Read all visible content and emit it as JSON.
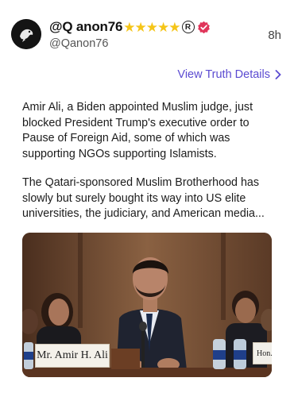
{
  "post": {
    "display_name": "@Q anon76",
    "handle": "@Qanon76",
    "time": "8h",
    "badges": {
      "stars": [
        "★",
        "★",
        "★",
        "★",
        "★"
      ],
      "registered": "R",
      "verified_color": "#e0355a"
    },
    "details_link": "View Truth Details",
    "paragraphs": [
      "Amir Ali, a Biden appointed Muslim judge, just blocked President Trump's executive order to Pause of Foreign Aid, some of which was supporting NGOs supporting Islamists.",
      "The Qatari-sponsored Muslim Brotherhood has slowly but surely bought its way into US elite universities, the judiciary, and American media..."
    ],
    "image": {
      "nameplate": "Mr. Amir H. Ali",
      "nameplate_2": "Hon."
    }
  },
  "colors": {
    "accent": "#5b4bd1",
    "star": "#f5c518"
  }
}
